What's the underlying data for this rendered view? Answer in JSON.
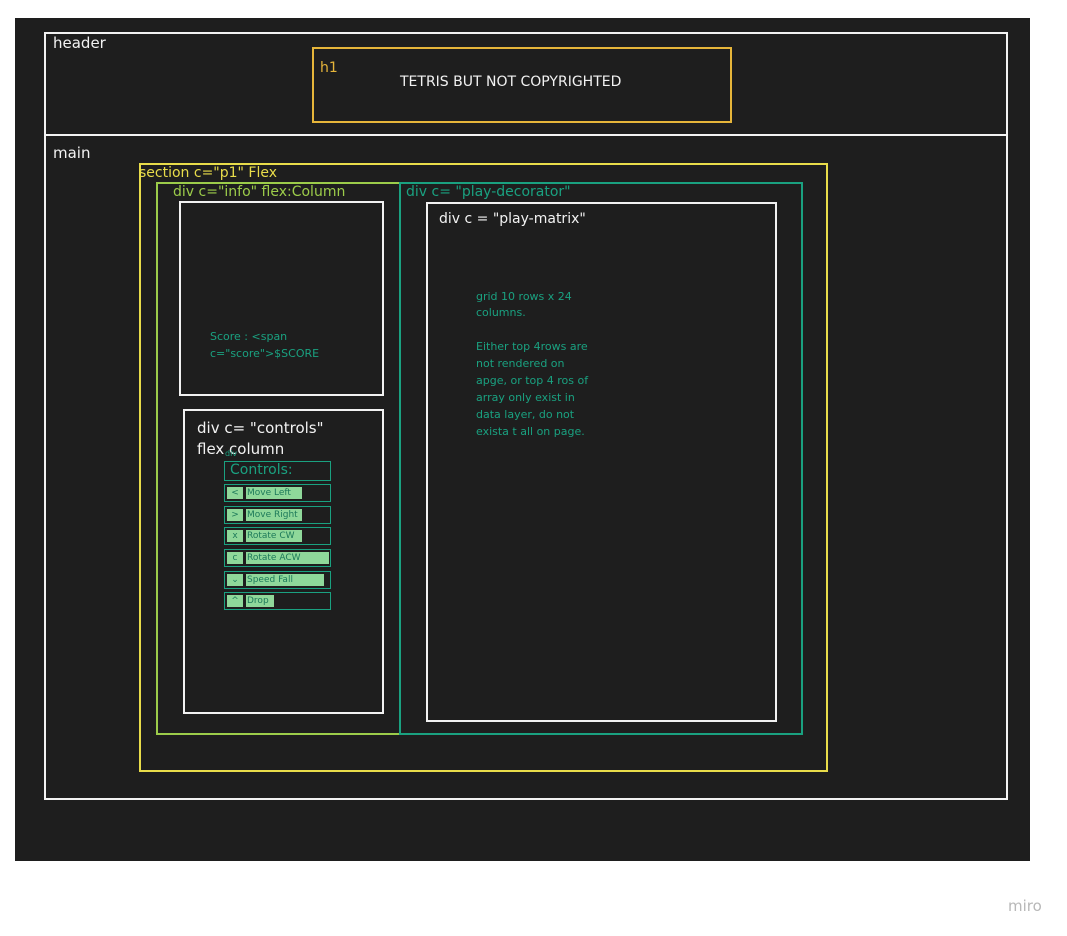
{
  "header": {
    "label": "header"
  },
  "h1": {
    "label": "h1",
    "title": "TETRIS BUT NOT COPYRIGHTED"
  },
  "main": {
    "label": "main"
  },
  "section": {
    "label": "section c=\"p1\"  Flex"
  },
  "info": {
    "label": "div c=\"info\" flex:Column",
    "score_text_line1": "Score : <span",
    "score_text_line2": "c=\"score\">$SCORE"
  },
  "controls": {
    "label_line1": "div c= \"controls\"",
    "label_line2": "flex column",
    "small_tag": "div",
    "heading": "Controls:",
    "items": [
      {
        "key": "<",
        "action": "Move Left"
      },
      {
        "key": ">",
        "action": "Move Right"
      },
      {
        "key": "x",
        "action": "Rotate CW"
      },
      {
        "key": "c",
        "action": "Rotate ACW"
      },
      {
        "key": "⌄",
        "action": "Speed Fall"
      },
      {
        "key": "^",
        "action": "Drop"
      }
    ]
  },
  "play_decorator": {
    "label": "div c= \"play-decorator\""
  },
  "play_matrix": {
    "label": "div c = \"play-matrix\"",
    "note_line1": "grid 10 rows x 24",
    "note_line2": "columns.",
    "note_para2": "Either top 4rows  are not rendered on apge, or top 4 ros of array only exist in data layer, do not exista t all on page."
  },
  "watermark": "miro"
}
